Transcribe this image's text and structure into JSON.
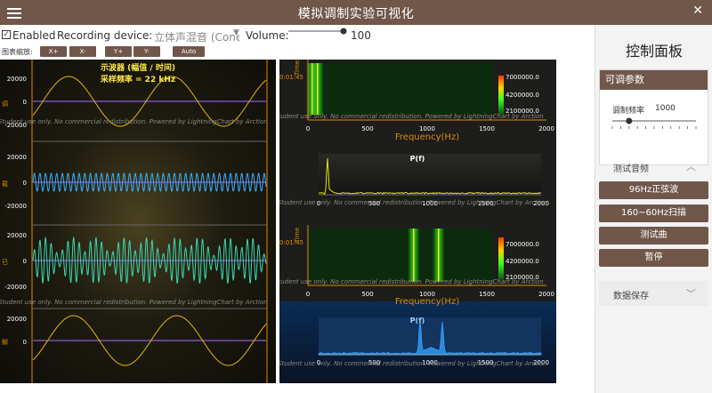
{
  "window": {
    "title": "模拟调制实验可视化",
    "close_glyph": "✕"
  },
  "toolbar": {
    "enabled_label": "Enabled",
    "enabled_checked": true,
    "recording_label": "Recording device:",
    "recording_value": "立体声混音 (Conexa",
    "volume_label": "Volume:",
    "volume_value": "100"
  },
  "zoom": {
    "label": "图表缩放:",
    "buttons": [
      "X+",
      "X-",
      "Y+",
      "Y-",
      "Auto"
    ]
  },
  "scope": {
    "title_line1": "示波器 (幅值 / 时间)",
    "title_line2": "采样频率 = 22 kHz",
    "watermark": "Student use only. No commercial redistribution. Powered by LightningChart by Arction",
    "axes": [
      {
        "ticks": [
          "20000",
          "0",
          "-20000"
        ],
        "label": "调"
      },
      {
        "ticks": [
          "20000",
          "0",
          "-20000"
        ],
        "label": "载"
      },
      {
        "ticks": [
          "20000",
          "0",
          "-20000"
        ],
        "label": "已"
      },
      {
        "ticks": [
          "20000",
          "0"
        ],
        "label": "解"
      }
    ]
  },
  "spectrum": {
    "spectrogram_legend": [
      "7000000.0",
      "4200000.0",
      "2100000.0"
    ],
    "time_label": "Time",
    "time_tick": "0:01:45",
    "freq_title": "Frequency(Hz)",
    "pf_label": "P(f)",
    "x_ticks": [
      "0",
      "500",
      "1000",
      "1500",
      "2000"
    ],
    "watermark": "Student use only. No commercial redistribution. Powered by LightningChart by Arction"
  },
  "panel": {
    "title": "控制面板",
    "params_header": "可调参数",
    "mod_freq_label": "调制频率",
    "mod_freq_value": "1000",
    "mod_freq_fraction": 0.2,
    "test_header": "测试音频",
    "buttons": [
      "96Hz正弦波",
      "160~60Hz扫描",
      "测试曲",
      "暂停"
    ],
    "save_header": "数据保存"
  }
}
